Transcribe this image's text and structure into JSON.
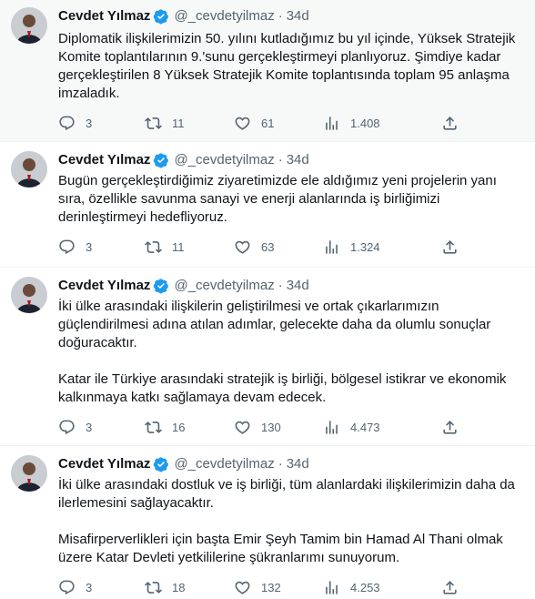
{
  "colors": {
    "accent": "#1d9bf0",
    "text": "#0f1419",
    "muted": "#536471",
    "highlight_bg": "#f7f9f9",
    "divider": "#eff3f4"
  },
  "tweets": [
    {
      "author": "Cevdet Yılmaz",
      "handle": "@_cevdetyilmaz",
      "time": "34d",
      "paragraphs": [
        "Diplomatik ilişkilerimizin 50. yılını kutladığımız bu yıl içinde, Yüksek Stratejik Komite toplantılarının 9.'sunu gerçekleştirmeyi planlıyoruz. Şimdiye kadar gerçekleştirilen 8 Yüksek Stratejik Komite toplantısında toplam 95 anlaşma imzaladık."
      ],
      "replies": "3",
      "retweets": "11",
      "likes": "61",
      "views": "1.408"
    },
    {
      "author": "Cevdet Yılmaz",
      "handle": "@_cevdetyilmaz",
      "time": "34d",
      "paragraphs": [
        "Bugün gerçekleştirdiğimiz ziyaretimizde ele aldığımız yeni projelerin yanı sıra, özellikle savunma sanayi ve enerji alanlarında iş birliğimizi derinleştirmeyi hedefliyoruz."
      ],
      "replies": "3",
      "retweets": "11",
      "likes": "63",
      "views": "1.324"
    },
    {
      "author": "Cevdet Yılmaz",
      "handle": "@_cevdetyilmaz",
      "time": "34d",
      "paragraphs": [
        "İki ülke arasındaki ilişkilerin geliştirilmesi ve ortak çıkarlarımızın güçlendirilmesi adına atılan adımlar, gelecekte daha da olumlu sonuçlar doğuracaktır.",
        "Katar ile Türkiye arasındaki stratejik iş birliği, bölgesel istikrar ve ekonomik kalkınmaya katkı sağlamaya devam edecek."
      ],
      "replies": "3",
      "retweets": "16",
      "likes": "130",
      "views": "4.473"
    },
    {
      "author": "Cevdet Yılmaz",
      "handle": "@_cevdetyilmaz",
      "time": "34d",
      "paragraphs": [
        "İki ülke arasındaki dostluk ve iş birliği, tüm alanlardaki ilişkilerimizin daha da ilerlemesini sağlayacaktır.",
        "Misafirperverlikleri için başta Emir Şeyh Tamim bin Hamad Al Thani olmak üzere Katar Devleti yetkililerine şükranlarımı sunuyorum."
      ],
      "replies": "3",
      "retweets": "18",
      "likes": "132",
      "views": "4.253"
    }
  ]
}
